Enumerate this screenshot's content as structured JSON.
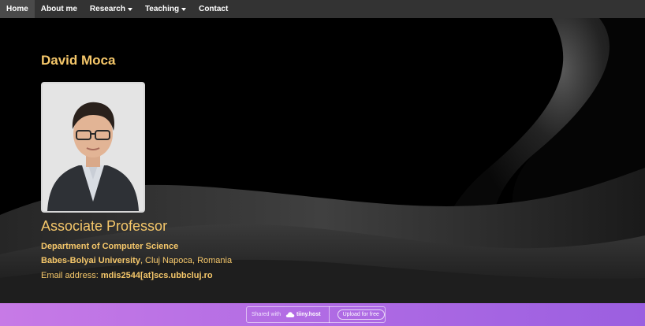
{
  "nav": {
    "items": [
      {
        "label": "Home",
        "active": true,
        "dropdown": false
      },
      {
        "label": "About me",
        "active": false,
        "dropdown": false
      },
      {
        "label": "Research",
        "active": false,
        "dropdown": true
      },
      {
        "label": "Teaching",
        "active": false,
        "dropdown": true
      },
      {
        "label": "Contact",
        "active": false,
        "dropdown": false
      }
    ]
  },
  "profile": {
    "name": "David Moca",
    "title": "Associate Professor",
    "department": "Department of Computer Science",
    "university": "Babes-Bolyai University",
    "location": ", Cluj Napoca, Romania",
    "email_label": "Email address: ",
    "email": "mdis2544[at]scs.ubbcluj.ro"
  },
  "banner": {
    "shared_label": "Shared with",
    "brand": "tiiny.host",
    "upload_label": "Upload for free"
  },
  "colors": {
    "accent": "#f5c76a",
    "nav_bg": "#333333",
    "nav_active_bg": "#4a4a4a",
    "banner_start": "#c77ae6",
    "banner_end": "#9b5fe0"
  }
}
